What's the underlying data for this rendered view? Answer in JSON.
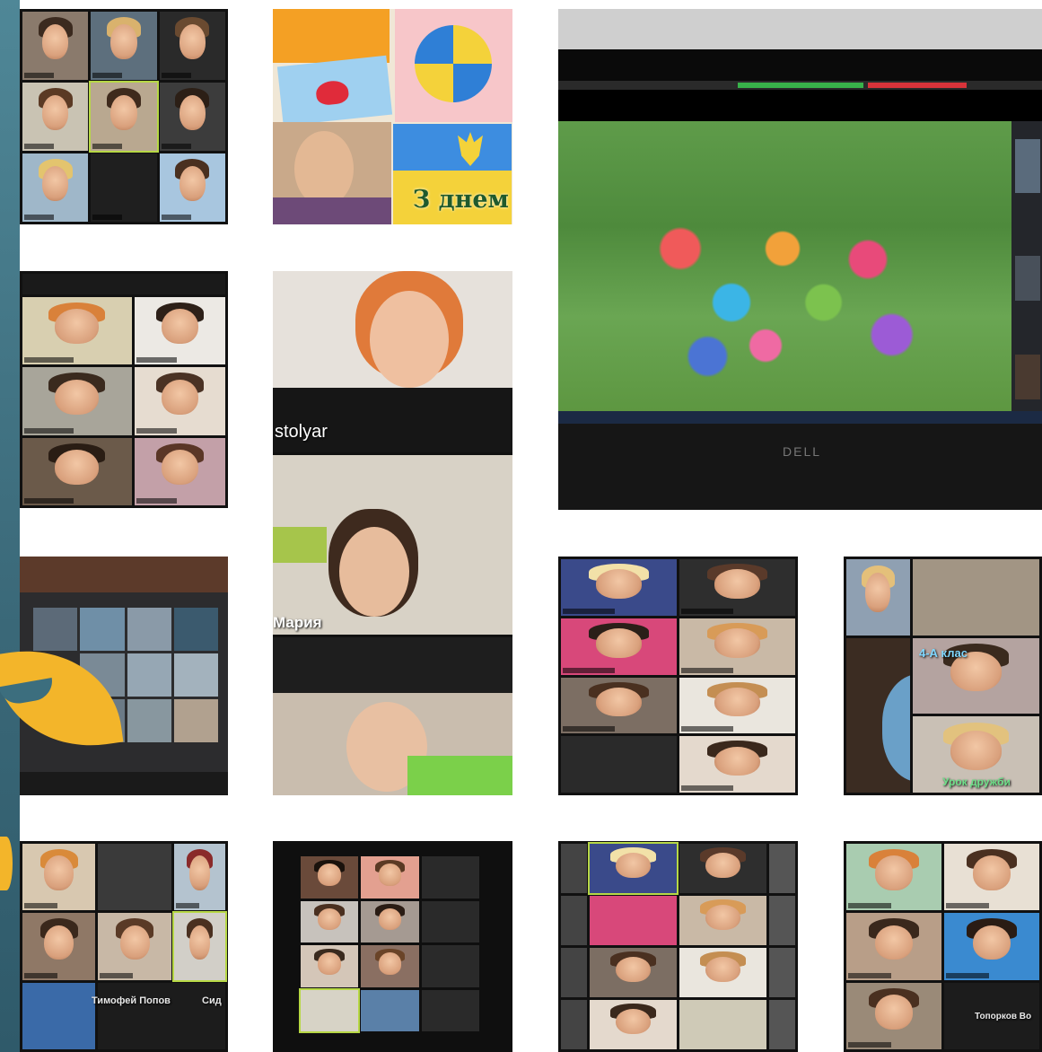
{
  "collage": {
    "background_color": "#ffffff",
    "accent_yellow": "#f3b52a",
    "slide_background": "#3c6e7e"
  },
  "tile_ukraine": {
    "greeting_text": "З днем"
  },
  "tile_teacher": {
    "name_overlay": "stolyar",
    "child_name_overlay": "Мария"
  },
  "tile_laptop": {
    "brand_text": "DELL"
  },
  "tile_zoom_b": {
    "class_overlay": "4-А клас",
    "lesson_overlay": "Урок дружби"
  },
  "tile_zoom_row4_a": {
    "name_1": "Тимофей Попов",
    "name_2": "Сид"
  },
  "tile_zoom_row4_d": {
    "name_1": "Топорков Во"
  }
}
